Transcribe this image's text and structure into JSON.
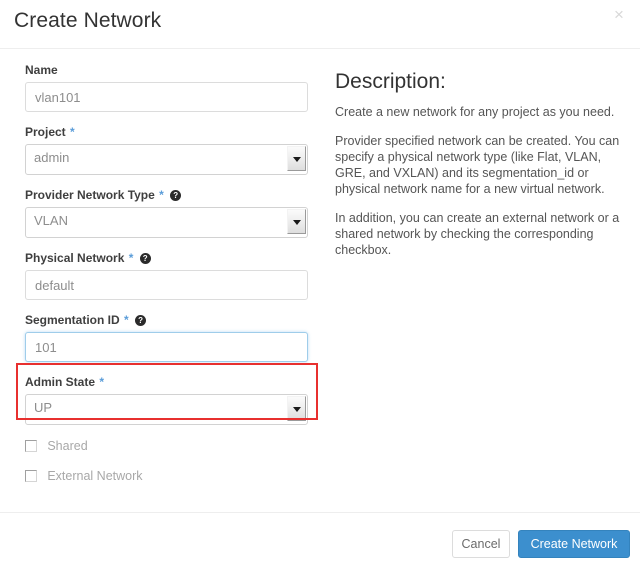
{
  "modal": {
    "title": "Create Network",
    "close_label": "×"
  },
  "form": {
    "fields": [
      {
        "name_key": "name",
        "label": "Name",
        "required": false,
        "help": false,
        "type": "text",
        "value": "vlan101",
        "placeholder": "vlan101"
      },
      {
        "name_key": "project",
        "label": "Project",
        "required": true,
        "help": false,
        "type": "select",
        "value": "admin"
      },
      {
        "name_key": "provider_network_type",
        "label": "Provider Network Type",
        "required": true,
        "help": true,
        "type": "select",
        "value": "VLAN"
      },
      {
        "name_key": "physical_network",
        "label": "Physical Network",
        "required": true,
        "help": true,
        "type": "text",
        "value": "default",
        "placeholder": "default"
      },
      {
        "name_key": "segmentation_id",
        "label": "Segmentation ID",
        "required": true,
        "help": true,
        "type": "text",
        "value": "101",
        "placeholder": "101",
        "focused": true,
        "highlighted": true
      },
      {
        "name_key": "admin_state",
        "label": "Admin State",
        "required": true,
        "help": false,
        "type": "select",
        "value": "UP"
      }
    ],
    "required_marker": "*",
    "help_glyph": "?",
    "checkboxes": [
      {
        "name_key": "shared",
        "label": "Shared",
        "checked": false
      },
      {
        "name_key": "external_network",
        "label": "External Network",
        "checked": false
      }
    ]
  },
  "description": {
    "title": "Description:",
    "paragraphs": [
      "Create a new network for any project as you need.",
      "Provider specified network can be created. You can specify a physical network type (like Flat, VLAN, GRE, and VXLAN) and its segmentation_id or physical network name for a new virtual network.",
      "In addition, you can create an external network or a shared network by checking the corresponding checkbox."
    ]
  },
  "footer": {
    "cancel_label": "Cancel",
    "submit_label": "Create Network"
  },
  "colors": {
    "primary_button": "#3c8fce",
    "required_star": "#5b9dd9",
    "annotation": "#e8302f",
    "focus_border": "#9fcdea"
  }
}
